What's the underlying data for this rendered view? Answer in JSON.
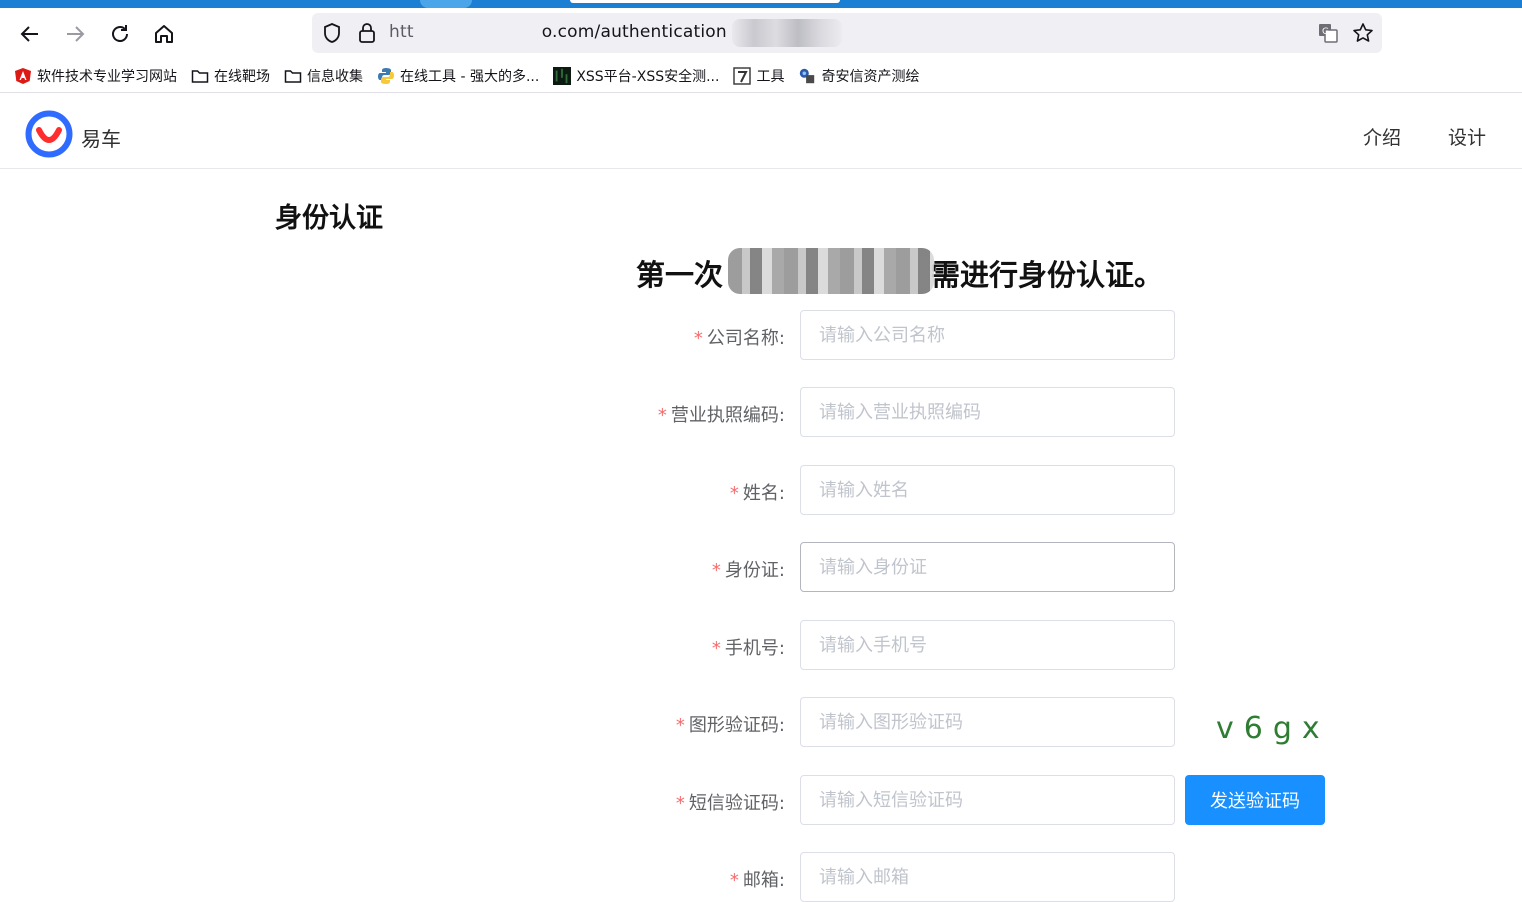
{
  "browser": {
    "url_prefix": "htt",
    "url_suffix": "o.com/authentication",
    "bookmarks": [
      {
        "label": "软件技术专业学习网站"
      },
      {
        "label": "在线靶场"
      },
      {
        "label": "信息收集"
      },
      {
        "label": "在线工具 - 强大的多..."
      },
      {
        "label": "XSS平台-XSS安全测..."
      },
      {
        "label": "工具"
      },
      {
        "label": "奇安信资产测绘"
      }
    ]
  },
  "site": {
    "brand": "易车",
    "menu": [
      "介绍",
      "设计"
    ]
  },
  "page": {
    "title": "身份认证",
    "notice_before": "第一次",
    "notice_after": "需进行身份认证。"
  },
  "form": {
    "required_mark": "*",
    "fields": [
      {
        "label": "公司名称:",
        "placeholder": "请输入公司名称"
      },
      {
        "label": "营业执照编码:",
        "placeholder": "请输入营业执照编码"
      },
      {
        "label": "姓名:",
        "placeholder": "请输入姓名"
      },
      {
        "label": "身份证:",
        "placeholder": "请输入身份证"
      },
      {
        "label": "手机号:",
        "placeholder": "请输入手机号"
      },
      {
        "label": "图形验证码:",
        "placeholder": "请输入图形验证码"
      },
      {
        "label": "短信验证码:",
        "placeholder": "请输入短信验证码"
      },
      {
        "label": "邮箱:",
        "placeholder": "请输入邮箱"
      }
    ],
    "captcha_text": "v6gx",
    "send_code_label": "发送验证码"
  },
  "colors": {
    "primary": "#1890ff",
    "required": "#f56c6c",
    "logo_blue": "#2f6bff",
    "logo_red": "#ff2d2d"
  }
}
